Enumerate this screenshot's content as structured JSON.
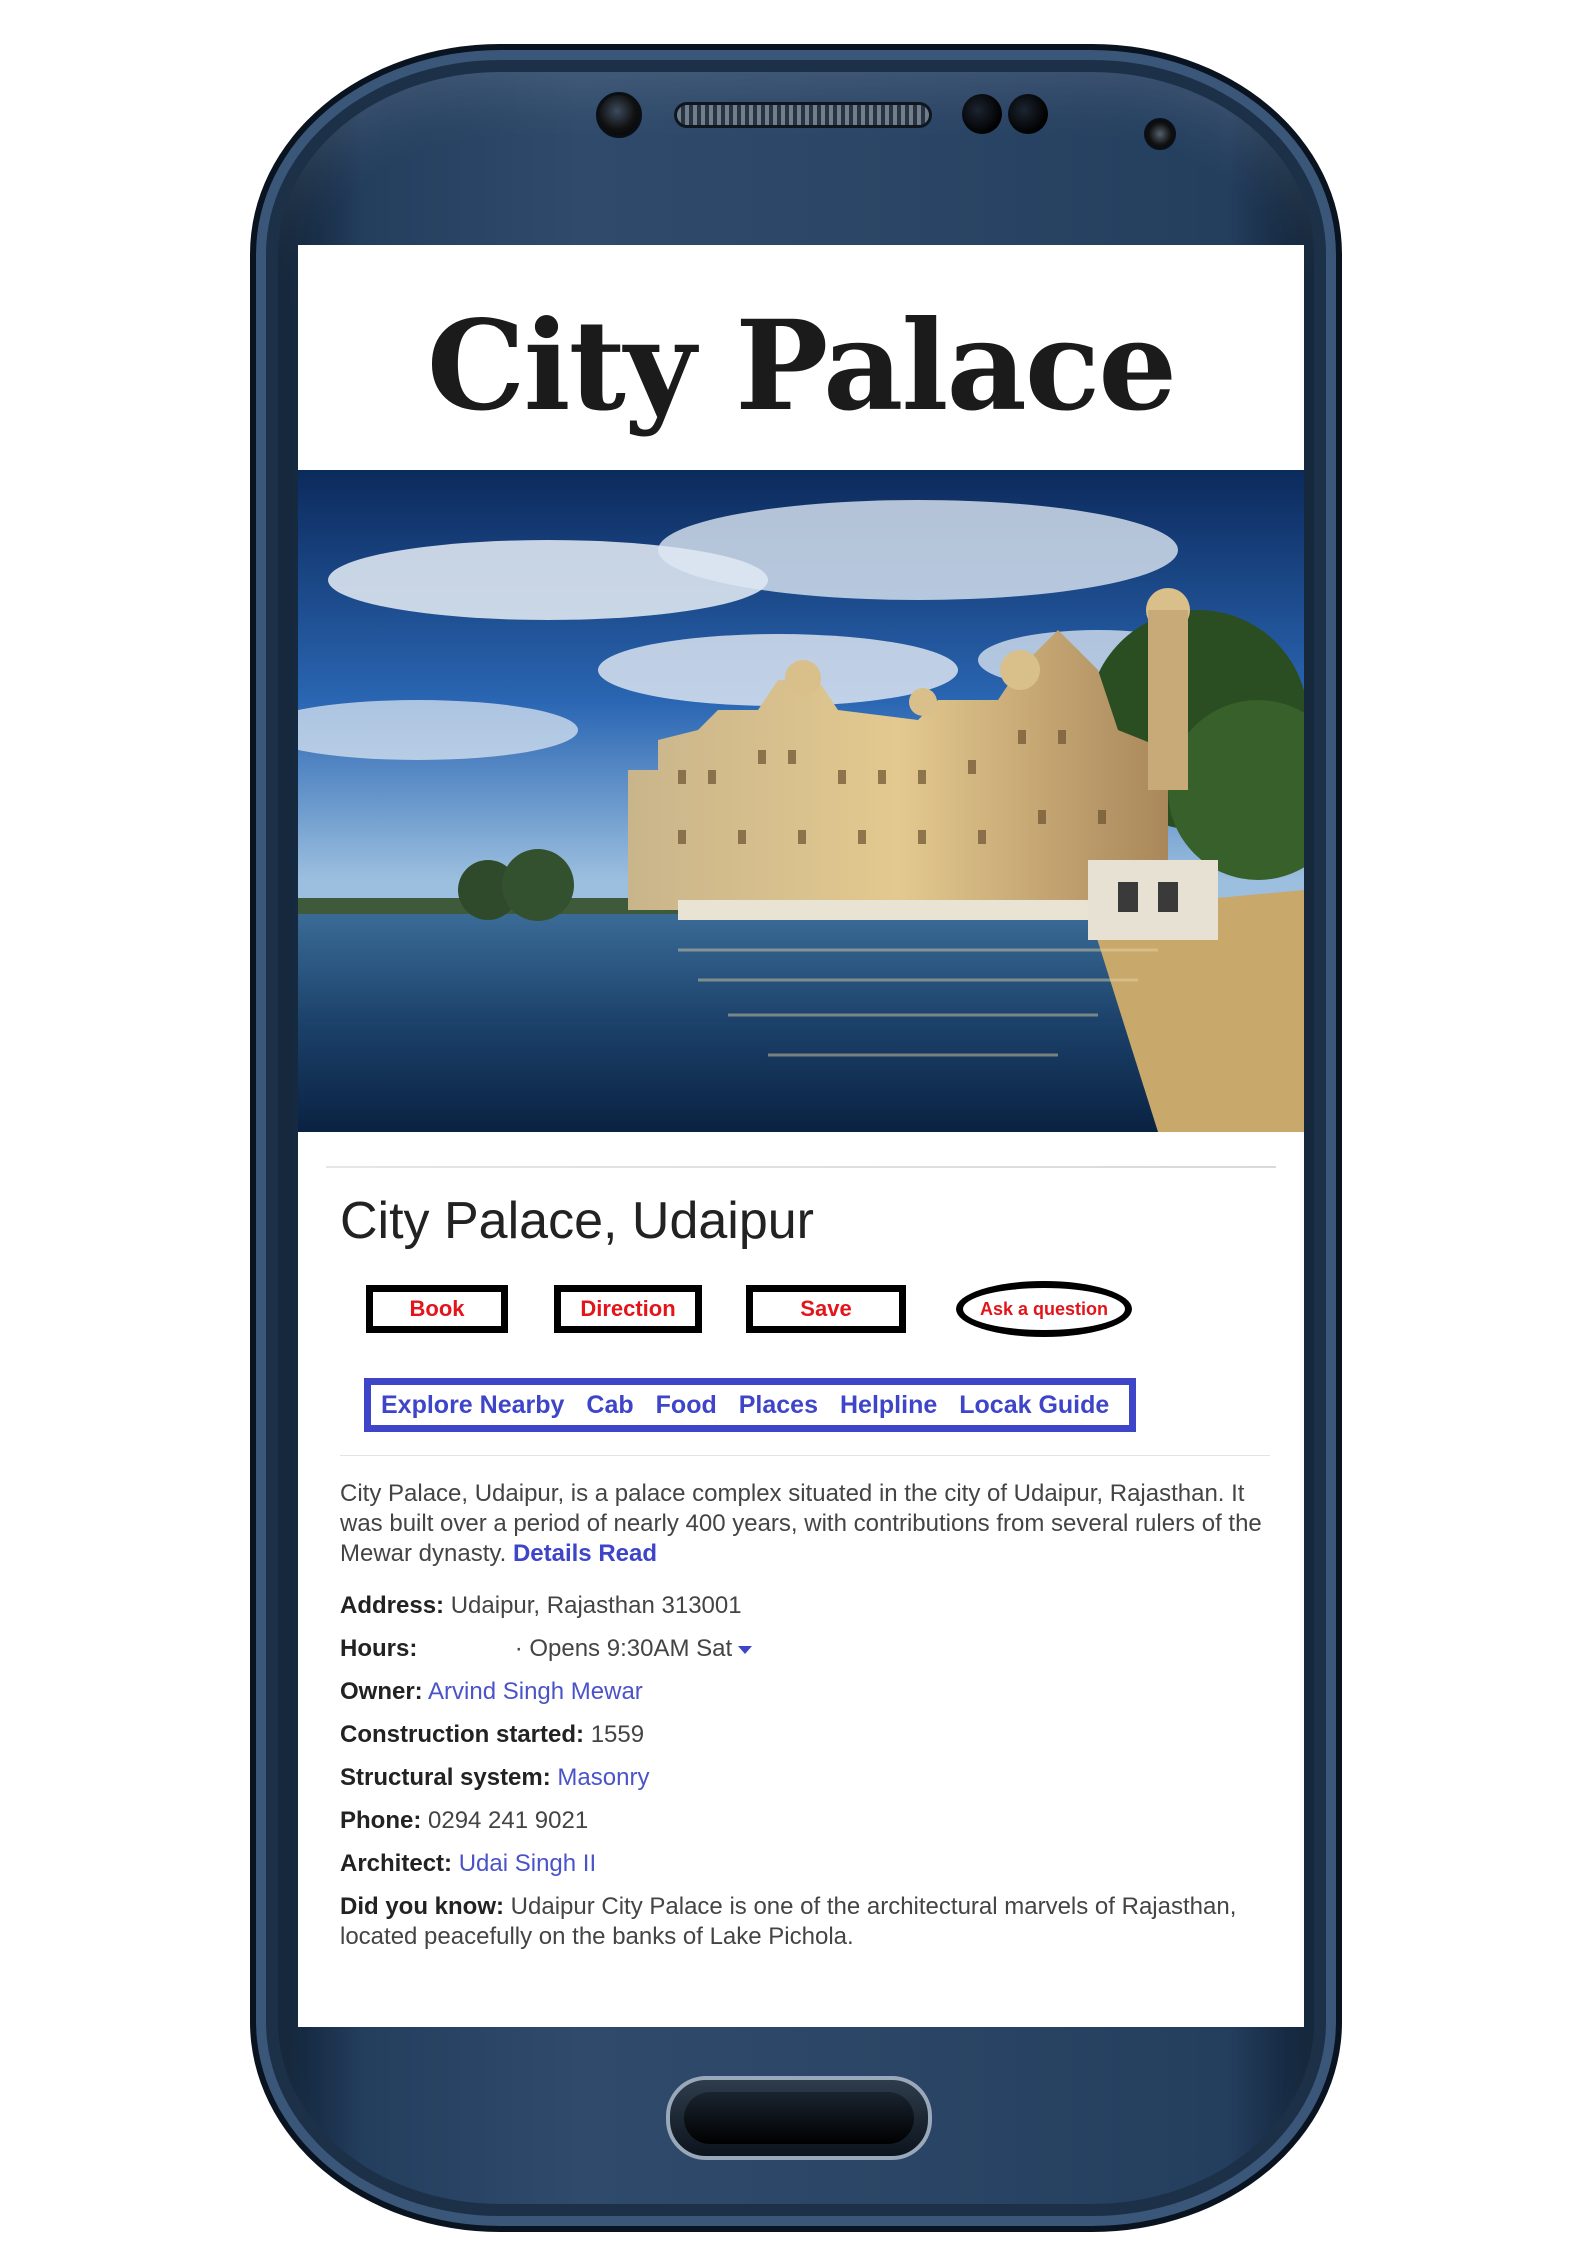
{
  "app": {
    "title": "City Palace"
  },
  "hero_image": {
    "description": "city-palace-photo"
  },
  "place": {
    "name": "City Palace, Udaipur"
  },
  "actions": {
    "book": "Book",
    "direction": "Direction",
    "save": "Save",
    "ask": "Ask a question"
  },
  "nav": {
    "items": [
      "Explore Nearby",
      "Cab",
      "Food",
      "Places",
      "Helpline",
      "Locak Guide"
    ]
  },
  "description": {
    "text": "City Palace, Udaipur, is a palace complex situated in the city of Udaipur, Rajasthan. It was built over a period of nearly 400 years, with contributions from several rulers of the Mewar dynasty.",
    "link": "Details Read"
  },
  "info": {
    "address_label": "Address:",
    "address_value": "Udaipur, Rajasthan 313001",
    "hours_label": "Hours:",
    "hours_value": "· Opens 9:30AM Sat",
    "owner_label": "Owner:",
    "owner_value": "Arvind Singh Mewar",
    "construction_label": "Construction started:",
    "construction_value": "1559",
    "structural_label": "Structural system:",
    "structural_value": "Masonry",
    "phone_label": "Phone:",
    "phone_value": "0294 241 9021",
    "architect_label": "Architect:",
    "architect_value": "Udai Singh II",
    "didyouknow_label": "Did you know:",
    "didyouknow_value": "Udaipur City Palace is one of the architectural marvels of Rajasthan, located peacefully on the banks of Lake Pichola."
  },
  "colors": {
    "accent_red": "#e3141a",
    "accent_blue": "#3e45c8",
    "phone_body": "#2b4566"
  }
}
